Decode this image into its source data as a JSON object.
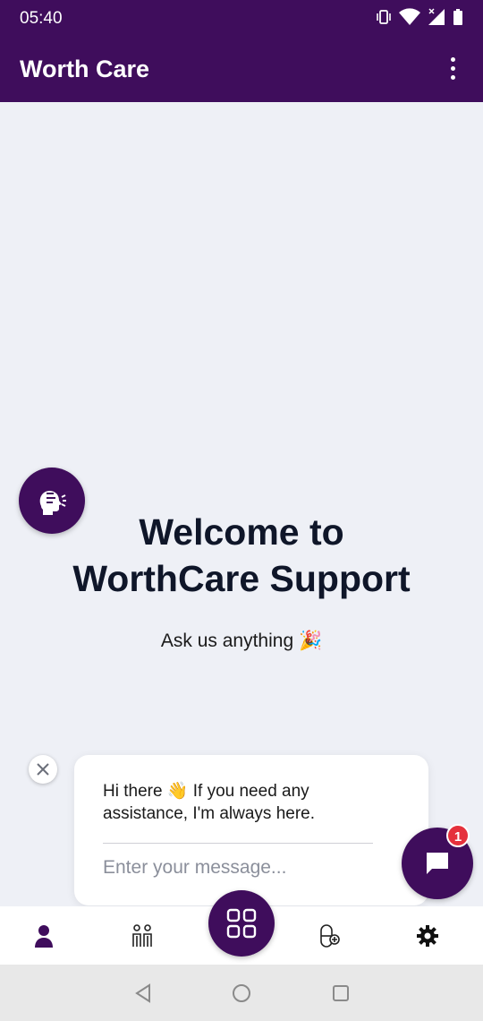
{
  "status_bar": {
    "time": "05:40"
  },
  "app_bar": {
    "title": "Worth Care"
  },
  "main": {
    "welcome_line1": "Welcome to",
    "welcome_line2": "WorthCare Support",
    "subtitle": "Ask us anything 🎉"
  },
  "chat_popup": {
    "greeting": "Hi there 👋 If you need any assistance, I'm always here.",
    "input_placeholder": "Enter your message...",
    "unread_count": "1"
  },
  "bottom_nav": {
    "items": [
      "profile",
      "family",
      "dashboard",
      "pill",
      "settings"
    ]
  },
  "colors": {
    "primary": "#3f0d5c",
    "background": "#eef0f6",
    "badge": "#e5313c"
  }
}
